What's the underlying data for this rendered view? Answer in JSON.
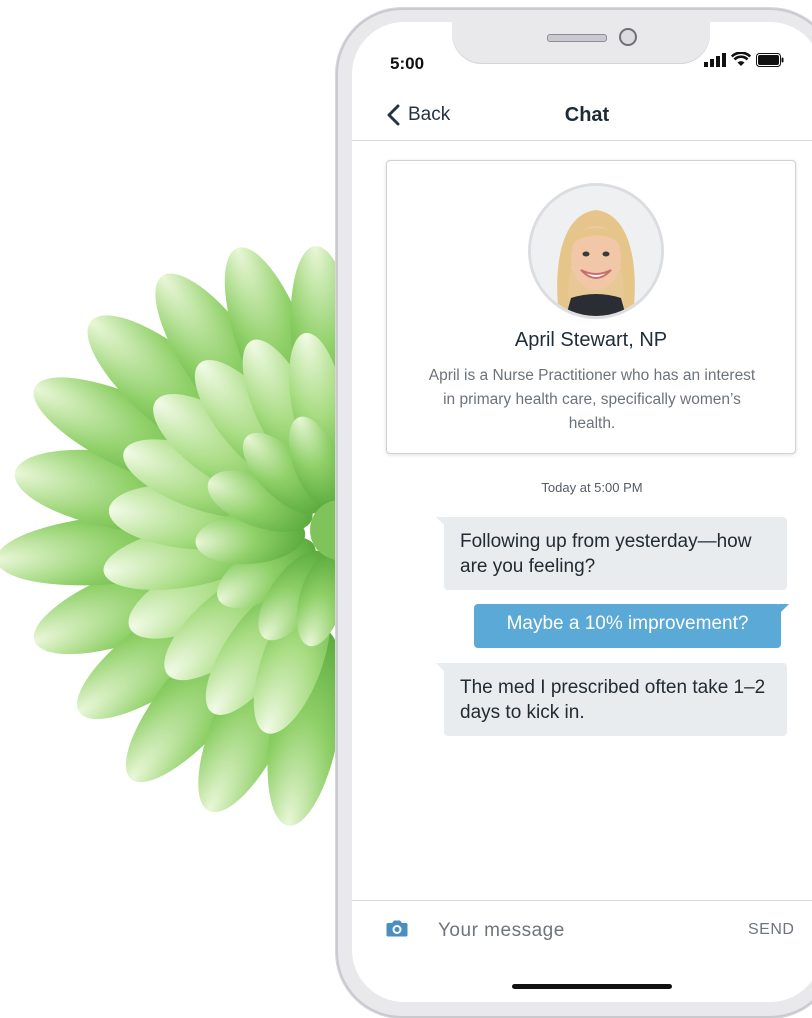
{
  "status_bar": {
    "time": "5:00"
  },
  "nav": {
    "back_label": "Back",
    "title": "Chat"
  },
  "provider": {
    "name": "April Stewart, NP",
    "bio": "April is a Nurse Practitioner who has an interest in primary health care, specifically women’s health."
  },
  "conversation": {
    "timestamp": "Today at 5:00 PM",
    "messages": [
      {
        "sender": "provider",
        "text": "Following up from yesterday—how are you feeling?"
      },
      {
        "sender": "user",
        "text": "Maybe a 10% improvement?"
      },
      {
        "sender": "provider",
        "text": "The med I prescribed often take 1–2 days to kick in."
      }
    ]
  },
  "composer": {
    "placeholder": "Your message",
    "send_label": "SEND"
  },
  "colors": {
    "accent": "#5aa9d6",
    "incoming_bubble": "#e8ecef",
    "flower": "#8fd068"
  },
  "icons": [
    "chevron-left-icon",
    "signal-icon",
    "wifi-icon",
    "battery-icon",
    "camera-icon"
  ]
}
